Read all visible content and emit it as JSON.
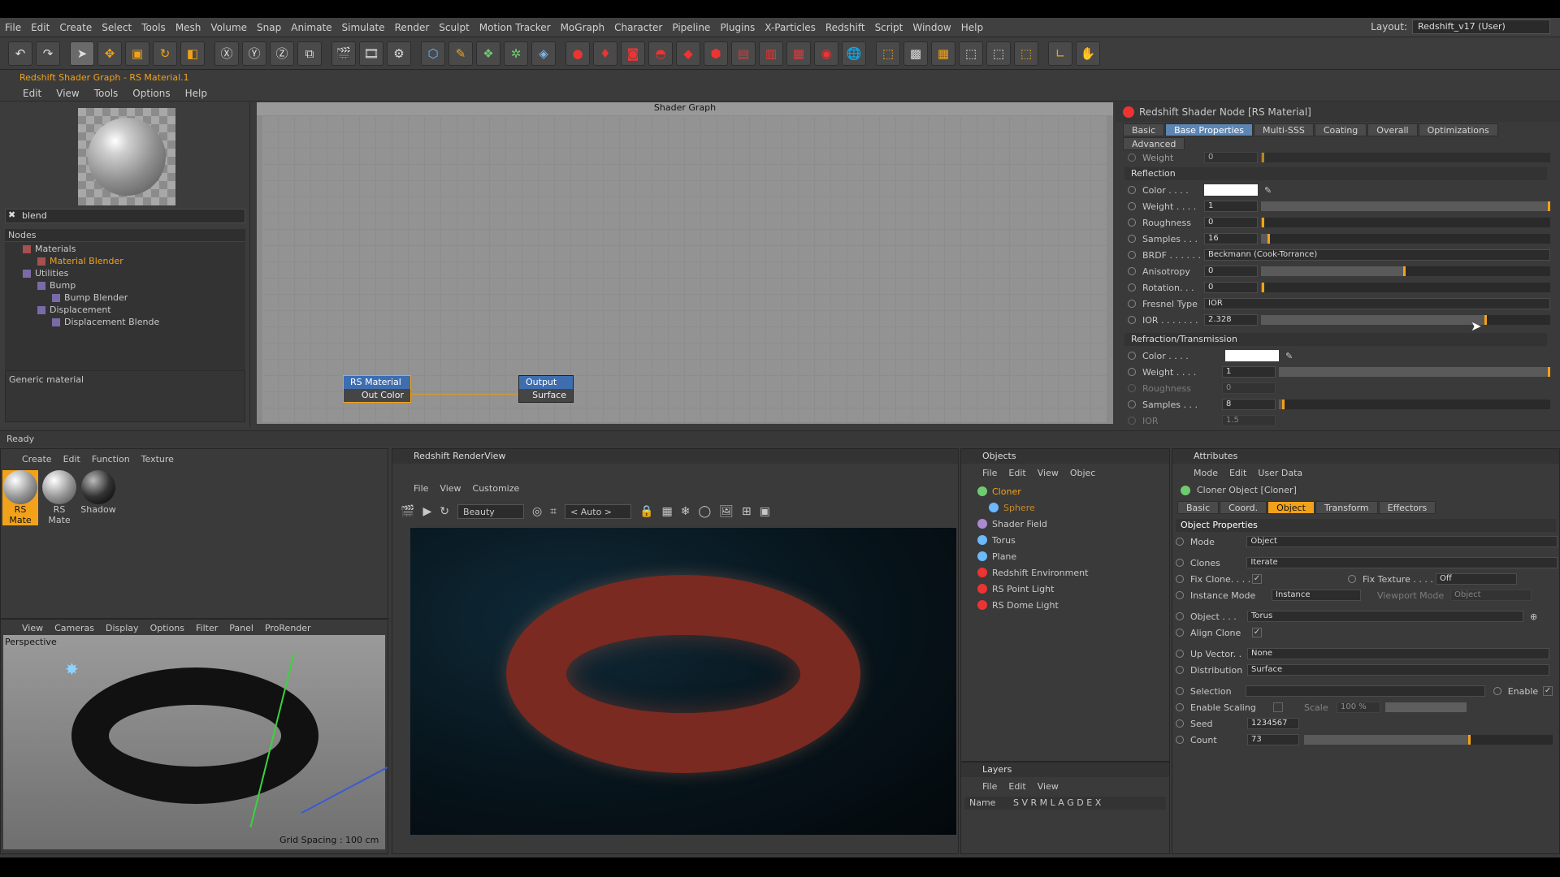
{
  "menubar": {
    "items": [
      "File",
      "Edit",
      "Create",
      "Select",
      "Tools",
      "Mesh",
      "Volume",
      "Snap",
      "Animate",
      "Simulate",
      "Render",
      "Sculpt",
      "Motion Tracker",
      "MoGraph",
      "Character",
      "Pipeline",
      "Plugins",
      "X-Particles",
      "Redshift",
      "Script",
      "Window",
      "Help"
    ],
    "layout_label": "Layout:",
    "layout_value": "Redshift_v17 (User)"
  },
  "shader_graph": {
    "window_title": "Redshift Shader Graph - RS Material.1",
    "menu": [
      "Edit",
      "View",
      "Tools",
      "Options",
      "Help"
    ],
    "search_value": "blend",
    "nodes_header": "Nodes",
    "tree": [
      "Materials",
      "Material Blender",
      "Utilities",
      "Bump",
      "Bump Blender",
      "Displacement",
      "Displacement Blende"
    ],
    "description": "Generic material",
    "graph_title": "Shader Graph",
    "node_rs_material": {
      "title": "RS Material",
      "port": "Out Color"
    },
    "node_output": {
      "title": "Output",
      "port": "Surface"
    }
  },
  "node_panel": {
    "title": "Redshift Shader Node [RS Material]",
    "tabs": [
      "Basic",
      "Base Properties",
      "Multi-SSS",
      "Coating",
      "Overall",
      "Optimizations",
      "Advanced"
    ],
    "weight_top": {
      "label": "Weight",
      "value": "0"
    },
    "reflection": {
      "header": "Reflection",
      "color_label": "Color . . . .",
      "weight": {
        "label": "Weight . . . .",
        "value": "1"
      },
      "roughness": {
        "label": "Roughness",
        "value": "0"
      },
      "samples": {
        "label": "Samples . . .",
        "value": "16"
      },
      "brdf": {
        "label": "BRDF . . . . . .",
        "value": "Beckmann (Cook-Torrance)"
      },
      "anisotropy": {
        "label": "Anisotropy",
        "value": "0"
      },
      "rotation": {
        "label": "Rotation. . .",
        "value": "0"
      },
      "fresnel": {
        "label": "Fresnel Type",
        "value": "IOR"
      },
      "ior": {
        "label": "IOR . . . . . . .",
        "value": "2.328"
      }
    },
    "refraction": {
      "header": "Refraction/Transmission",
      "color_label": "Color . . . .",
      "weight": {
        "label": "Weight . . . .",
        "value": "1"
      },
      "roughness": {
        "label": "Roughness",
        "value": "0"
      },
      "samples": {
        "label": "Samples . . .",
        "value": "8"
      },
      "ior": {
        "label": "IOR",
        "value": "1.5"
      }
    }
  },
  "status": "Ready",
  "material_manager": {
    "menu": [
      "Create",
      "Edit",
      "Function",
      "Texture"
    ],
    "materials": [
      "RS Mate",
      "RS Mate",
      "Shadow"
    ]
  },
  "viewport": {
    "menu": [
      "View",
      "Cameras",
      "Display",
      "Options",
      "Filter",
      "Panel",
      "ProRender"
    ],
    "label": "Perspective",
    "grid": "Grid Spacing : 100 cm"
  },
  "renderview": {
    "title": "Redshift RenderView",
    "menu": [
      "File",
      "View",
      "Customize"
    ],
    "aov": "Beauty",
    "zoom": "< Auto >"
  },
  "objects": {
    "title": "Objects",
    "menu": [
      "File",
      "Edit",
      "View",
      "Objec"
    ],
    "items": [
      "Cloner",
      "Sphere",
      "Shader Field",
      "Torus",
      "Plane",
      "Redshift Environment",
      "RS Point Light",
      "RS Dome Light"
    ]
  },
  "layers": {
    "title": "Layers",
    "menu": [
      "File",
      "Edit",
      "View"
    ],
    "name_col": "Name",
    "cols": "S V R M L A G D E X"
  },
  "attributes": {
    "title": "Attributes",
    "menu": [
      "Mode",
      "Edit",
      "User Data"
    ],
    "object_title": "Cloner Object [Cloner]",
    "tabs": [
      "Basic",
      "Coord.",
      "Object",
      "Transform",
      "Effectors"
    ],
    "section": "Object Properties",
    "mode": {
      "label": "Mode",
      "value": "Object"
    },
    "clones": {
      "label": "Clones",
      "value": "Iterate"
    },
    "fix_clone": "Fix Clone. . . .",
    "fix_texture": {
      "label": "Fix Texture . . . .",
      "value": "Off"
    },
    "instance_mode": {
      "label": "Instance Mode",
      "value": "Instance"
    },
    "viewport_mode": {
      "label": "Viewport Mode",
      "value": "Object"
    },
    "object": {
      "label": "Object . . .",
      "value": "Torus"
    },
    "align_clone": "Align Clone",
    "up_vector": {
      "label": "Up Vector. .",
      "value": "None"
    },
    "distribution": {
      "label": "Distribution",
      "value": "Surface"
    },
    "selection": "Selection",
    "enable": "Enable",
    "enable_scaling": "Enable Scaling",
    "scale": {
      "label": "Scale",
      "value": "100 %"
    },
    "seed": {
      "label": "Seed",
      "value": "1234567"
    },
    "count": {
      "label": "Count",
      "value": "73"
    }
  }
}
